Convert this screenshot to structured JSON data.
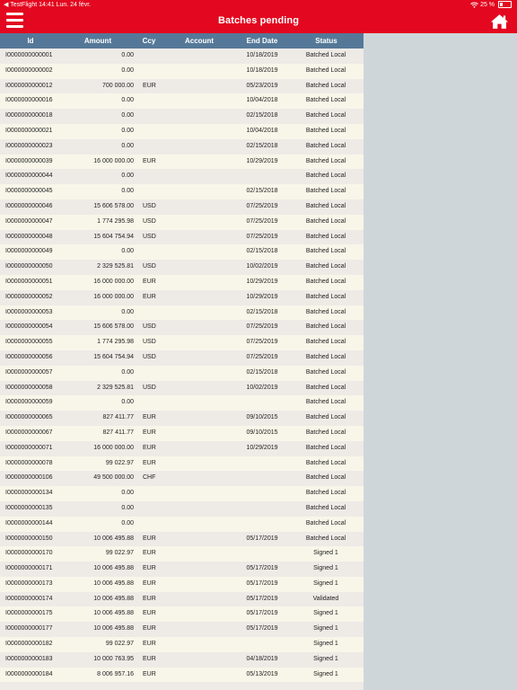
{
  "status_bar": {
    "left": "◀ TestFlight  14:41  Lun. 24 févr.",
    "battery": "25 %"
  },
  "header": {
    "title": "Batches pending"
  },
  "table": {
    "columns": [
      "Id",
      "Amount",
      "Ccy",
      "Account",
      "End Date",
      "Status"
    ],
    "rows": [
      [
        "I0000000000001",
        "0.00",
        "",
        "",
        "10/18/2019",
        "Batched Local"
      ],
      [
        "I0000000000002",
        "0.00",
        "",
        "",
        "10/18/2019",
        "Batched Local"
      ],
      [
        "I0000000000012",
        "700 000.00",
        "EUR",
        "",
        "05/23/2019",
        "Batched Local"
      ],
      [
        "I0000000000016",
        "0.00",
        "",
        "",
        "10/04/2018",
        "Batched Local"
      ],
      [
        "I0000000000018",
        "0.00",
        "",
        "",
        "02/15/2018",
        "Batched Local"
      ],
      [
        "I0000000000021",
        "0.00",
        "",
        "",
        "10/04/2018",
        "Batched Local"
      ],
      [
        "I0000000000023",
        "0.00",
        "",
        "",
        "02/15/2018",
        "Batched Local"
      ],
      [
        "I0000000000039",
        "16 000 000.00",
        "EUR",
        "",
        "10/29/2019",
        "Batched Local"
      ],
      [
        "I0000000000044",
        "0.00",
        "",
        "",
        "",
        "Batched Local"
      ],
      [
        "I0000000000045",
        "0.00",
        "",
        "",
        "02/15/2018",
        "Batched Local"
      ],
      [
        "I0000000000046",
        "15 606 578.00",
        "USD",
        "",
        "07/25/2019",
        "Batched Local"
      ],
      [
        "I0000000000047",
        "1 774 295.98",
        "USD",
        "",
        "07/25/2019",
        "Batched Local"
      ],
      [
        "I0000000000048",
        "15 604 754.94",
        "USD",
        "",
        "07/25/2019",
        "Batched Local"
      ],
      [
        "I0000000000049",
        "0.00",
        "",
        "",
        "02/15/2018",
        "Batched Local"
      ],
      [
        "I0000000000050",
        "2 329 525.81",
        "USD",
        "",
        "10/02/2019",
        "Batched Local"
      ],
      [
        "I0000000000051",
        "16 000 000.00",
        "EUR",
        "",
        "10/29/2019",
        "Batched Local"
      ],
      [
        "I0000000000052",
        "16 000 000.00",
        "EUR",
        "",
        "10/29/2019",
        "Batched Local"
      ],
      [
        "I0000000000053",
        "0.00",
        "",
        "",
        "02/15/2018",
        "Batched Local"
      ],
      [
        "I0000000000054",
        "15 606 578.00",
        "USD",
        "",
        "07/25/2019",
        "Batched Local"
      ],
      [
        "I0000000000055",
        "1 774 295.98",
        "USD",
        "",
        "07/25/2019",
        "Batched Local"
      ],
      [
        "I0000000000056",
        "15 604 754.94",
        "USD",
        "",
        "07/25/2019",
        "Batched Local"
      ],
      [
        "I0000000000057",
        "0.00",
        "",
        "",
        "02/15/2018",
        "Batched Local"
      ],
      [
        "I0000000000058",
        "2 329 525.81",
        "USD",
        "",
        "10/02/2019",
        "Batched Local"
      ],
      [
        "I0000000000059",
        "0.00",
        "",
        "",
        "",
        "Batched Local"
      ],
      [
        "I0000000000065",
        "827 411.77",
        "EUR",
        "",
        "09/10/2015",
        "Batched Local"
      ],
      [
        "I0000000000067",
        "827 411.77",
        "EUR",
        "",
        "09/10/2015",
        "Batched Local"
      ],
      [
        "I0000000000071",
        "16 000 000.00",
        "EUR",
        "",
        "10/29/2019",
        "Batched Local"
      ],
      [
        "I0000000000078",
        "99 022.97",
        "EUR",
        "",
        "",
        "Batched Local"
      ],
      [
        "I0000000000106",
        "49 500 000.00",
        "CHF",
        "",
        "",
        "Batched Local"
      ],
      [
        "I0000000000134",
        "0.00",
        "",
        "",
        "",
        "Batched Local"
      ],
      [
        "I0000000000135",
        "0.00",
        "",
        "",
        "",
        "Batched Local"
      ],
      [
        "I0000000000144",
        "0.00",
        "",
        "",
        "",
        "Batched Local"
      ],
      [
        "I0000000000150",
        "10 006 495.88",
        "EUR",
        "",
        "05/17/2019",
        "Batched Local"
      ],
      [
        "I0000000000170",
        "99 022.97",
        "EUR",
        "",
        "",
        "Signed 1"
      ],
      [
        "I0000000000171",
        "10 006 495.88",
        "EUR",
        "",
        "05/17/2019",
        "Signed 1"
      ],
      [
        "I0000000000173",
        "10 006 495.88",
        "EUR",
        "",
        "05/17/2019",
        "Signed 1"
      ],
      [
        "I0000000000174",
        "10 006 495.88",
        "EUR",
        "",
        "05/17/2019",
        "Validated"
      ],
      [
        "I0000000000175",
        "10 006 495.88",
        "EUR",
        "",
        "05/17/2019",
        "Signed 1"
      ],
      [
        "I0000000000177",
        "10 006 495.88",
        "EUR",
        "",
        "05/17/2019",
        "Signed 1"
      ],
      [
        "I0000000000182",
        "99 022.97",
        "EUR",
        "",
        "",
        "Signed 1"
      ],
      [
        "I0000000000183",
        "10 000 763.95",
        "EUR",
        "",
        "04/18/2019",
        "Signed 1"
      ],
      [
        "I0000000000184",
        "8 006 957.16",
        "EUR",
        "",
        "05/13/2019",
        "Signed 1"
      ],
      [
        "",
        "",
        "",
        "",
        "",
        ""
      ]
    ]
  },
  "colors": {
    "header_bg": "#e3081f",
    "table_header_bg": "#557898",
    "row_odd": "#eeeae6",
    "row_even": "#f8f6e9",
    "side_panel": "#cfd6da"
  },
  "icons": {
    "menu": "hamburger-menu-icon",
    "home": "home-icon",
    "wifi": "wifi-icon",
    "battery": "battery-icon"
  },
  "battery_level": 0.25
}
